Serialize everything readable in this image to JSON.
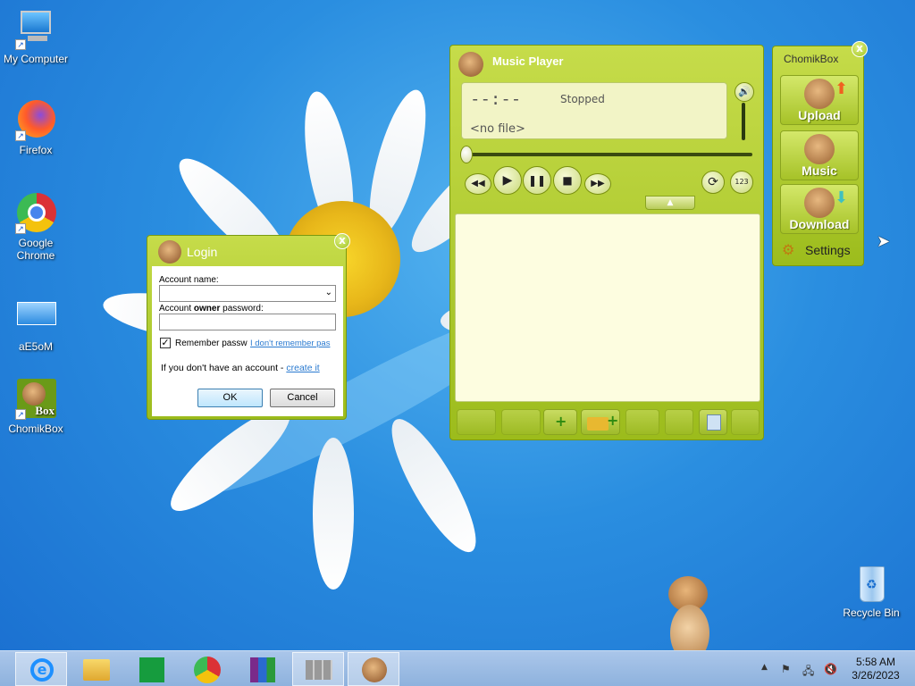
{
  "desktop": {
    "icons": [
      {
        "label": "My Computer"
      },
      {
        "label": "Firefox"
      },
      {
        "label": "Google Chrome"
      },
      {
        "label": "aE5oM"
      },
      {
        "label": "ChomikBox",
        "badge": "Box"
      },
      {
        "label": "Recycle Bin"
      }
    ]
  },
  "login": {
    "title": "Login",
    "account_name_label": "Account name:",
    "password_label_pre": "Account ",
    "password_label_bold": "owner",
    "password_label_post": " password:",
    "account_name_value": "",
    "password_value": "",
    "remember_label": "Remember passw",
    "remember_checked": true,
    "forgot_link": "I don't remember pas",
    "no_account_text": "If you don't have an account -",
    "create_link": "create it",
    "ok_label": "OK",
    "cancel_label": "Cancel",
    "close_label": "x"
  },
  "player": {
    "title": "Music Player",
    "time": "--:--",
    "status": "Stopped",
    "file": "<no file>",
    "repeat_badge": "123",
    "close_label": "x"
  },
  "chomikbox": {
    "title": "ChomikBox",
    "upload_label": "Upload",
    "music_label": "Music",
    "download_label": "Download",
    "settings_label": "Settings",
    "close_label": "x"
  },
  "taskbar": {
    "time": "5:58 AM",
    "date": "3/26/2023"
  },
  "colors": {
    "accent_green": "#9cbc1c",
    "desktop_blue": "#2a8ee0"
  }
}
